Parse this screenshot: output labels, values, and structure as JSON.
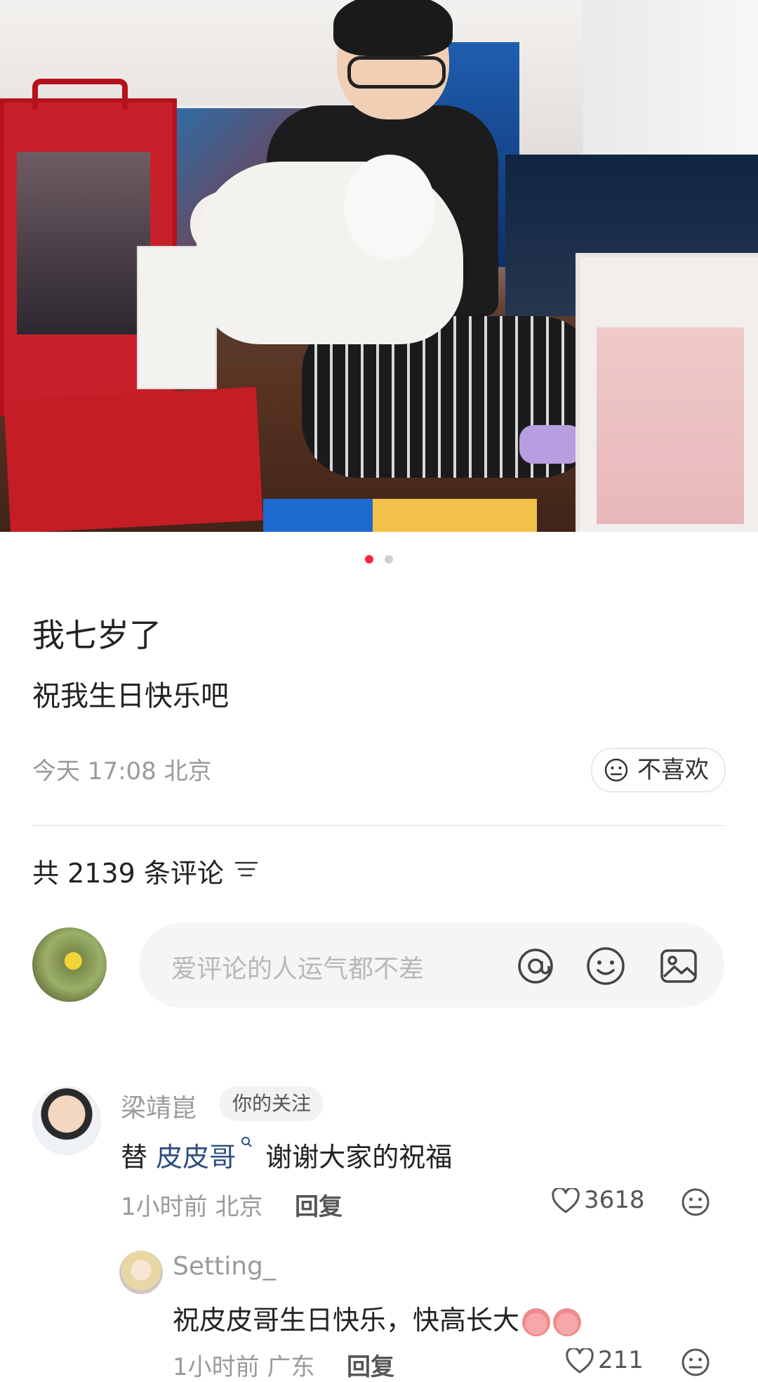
{
  "post": {
    "image_alt": "photo of a child holding a white dog surrounded by gift boxes",
    "dots": {
      "active_index": 0,
      "count": 2
    },
    "title": "我七岁了",
    "description": "祝我生日快乐吧",
    "meta": "今天 17:08 北京",
    "dislike_label": "不喜欢"
  },
  "comments_header": {
    "count_label": "共 2139 条评论"
  },
  "comment_input": {
    "placeholder": "爱评论的人运气都不差",
    "icons": [
      "at-icon",
      "emoji-icon",
      "image-icon"
    ]
  },
  "comments": [
    {
      "author": "梁靖崑",
      "badge": "你的关注",
      "text_prefix": "替 ",
      "mention": "皮皮哥",
      "text_suffix": " 谢谢大家的祝福",
      "time_location": "1小时前 北京",
      "reply_label": "回复",
      "likes": "3618"
    }
  ],
  "reply": {
    "author": "Setting_",
    "text": "祝皮皮哥生日快乐，快高长大",
    "time_location": "1小时前 广东",
    "reply_label": "回复",
    "likes": "211"
  },
  "colors": {
    "accent": "#ff2442",
    "link": "#2c4e80",
    "muted": "#9a9a9a"
  }
}
